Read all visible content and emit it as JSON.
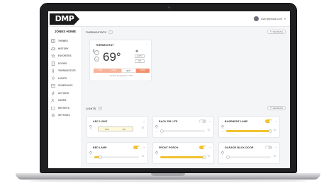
{
  "app": {
    "logo_text": "DMP",
    "user_email": "user@email.com",
    "home_name": "JONES HOME"
  },
  "sidebar": {
    "items": [
      {
        "label": "THEMES",
        "icon": "grid-icon"
      },
      {
        "label": "HISTORY",
        "icon": "cloud-icon"
      },
      {
        "label": "FAVORITES",
        "icon": "star-icon"
      },
      {
        "label": "DOORS",
        "icon": "door-icon"
      },
      {
        "label": "THERMOSTATS",
        "icon": "thermometer-icon"
      },
      {
        "label": "LIGHTS",
        "icon": "bulb-icon"
      },
      {
        "label": "SCHEDULES",
        "icon": "calendar-icon"
      },
      {
        "label": "ACTIONS",
        "icon": "bolt-icon"
      },
      {
        "label": "USERS",
        "icon": "users-icon"
      },
      {
        "label": "REPORTS",
        "icon": "folder-icon"
      },
      {
        "label": "SETTINGS",
        "icon": "gear-icon"
      }
    ]
  },
  "thermostats_section": {
    "title": "THERMOSTATS",
    "count": "1",
    "refresh_label": "REFRESH"
  },
  "thermostat": {
    "title": "THERMOSTAT",
    "setpoint": "69°",
    "fan_modes": [
      "AUTO",
      "ON"
    ],
    "modes": [
      "OFF",
      "COOL",
      "HEAT",
      "AUTO"
    ],
    "active_mode": "HEAT",
    "current_temp_note": "Current temperature: 70°F"
  },
  "lights_section": {
    "title": "LIGHTS",
    "count": "6",
    "refresh_label": "REFRESH"
  },
  "lights": [
    {
      "name": "ARC LIGHT",
      "control": "onoff",
      "off_label": "OFF",
      "on_label": "ON"
    },
    {
      "name": "BACK DR LITE",
      "control": "dimmer",
      "on": false,
      "level": 0
    },
    {
      "name": "BASEMENT LAMP",
      "control": "dimmer",
      "on": true,
      "level": 100
    },
    {
      "name": "BED LAMP",
      "control": "dimmer",
      "on": true,
      "level": 15
    },
    {
      "name": "FRONT PORCH",
      "control": "dimmer",
      "on": true,
      "level": 100
    },
    {
      "name": "GARAGE BACK DOOR",
      "control": "dimmer",
      "on": false,
      "level": 0
    }
  ],
  "colors": {
    "accent": "#f2c230",
    "heat": "#f29070",
    "sidebar_text": "#666666"
  }
}
